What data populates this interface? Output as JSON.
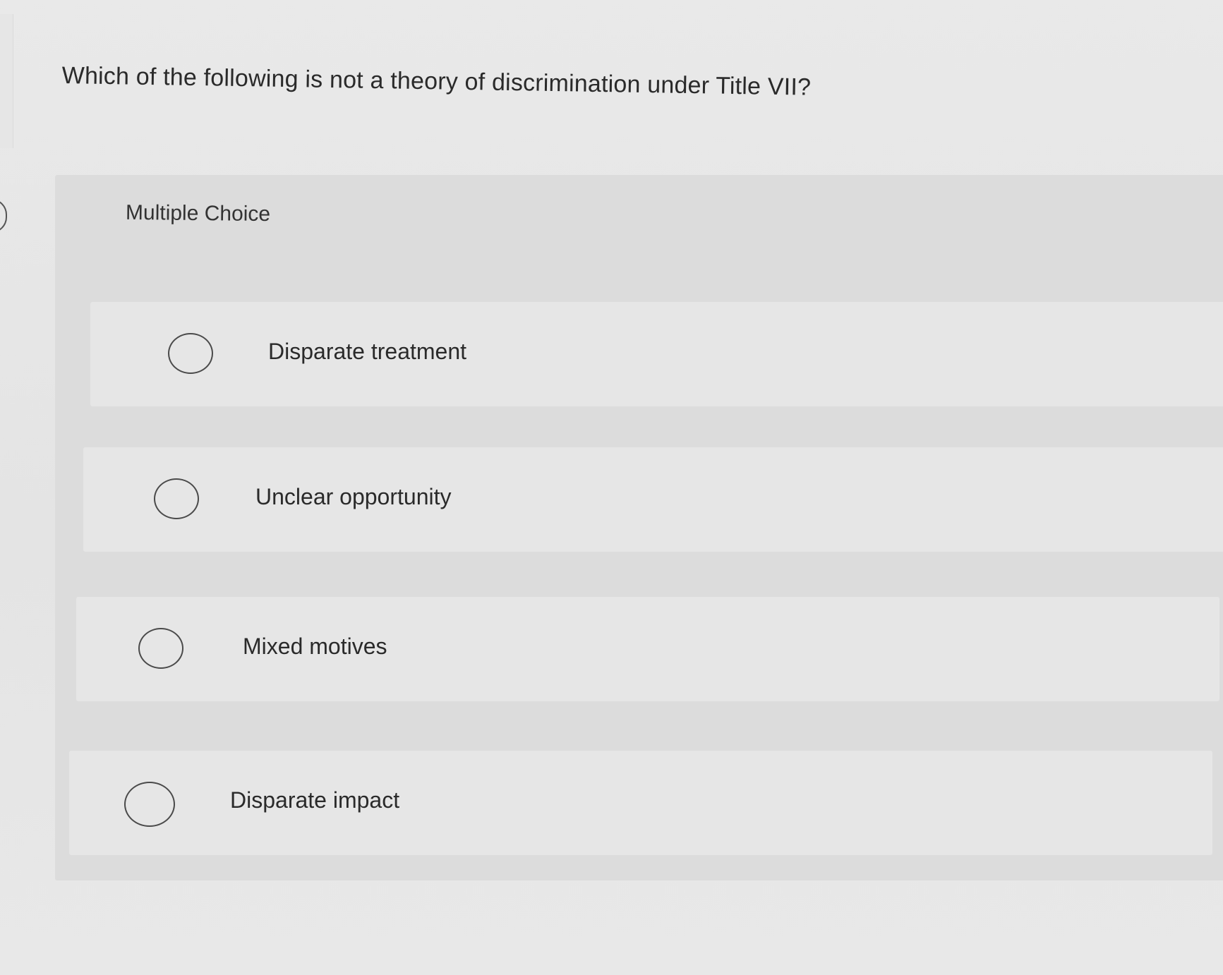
{
  "question": {
    "text": "Which of the following is not a theory of discrimination under Title VII?"
  },
  "multiple_choice": {
    "label": "Multiple Choice",
    "options": [
      {
        "label": "Disparate treatment",
        "selected": false
      },
      {
        "label": "Unclear opportunity",
        "selected": false
      },
      {
        "label": "Mixed motives",
        "selected": false
      },
      {
        "label": "Disparate impact",
        "selected": false
      }
    ]
  },
  "icons": {
    "option_radio": "radio-unchecked-icon"
  },
  "colors": {
    "background": "#e6e6e6",
    "panel": "#dcdcdc",
    "option_row": "#e6e6e6",
    "text": "#2a2a2a",
    "radio_border": "#4a4a4a"
  }
}
